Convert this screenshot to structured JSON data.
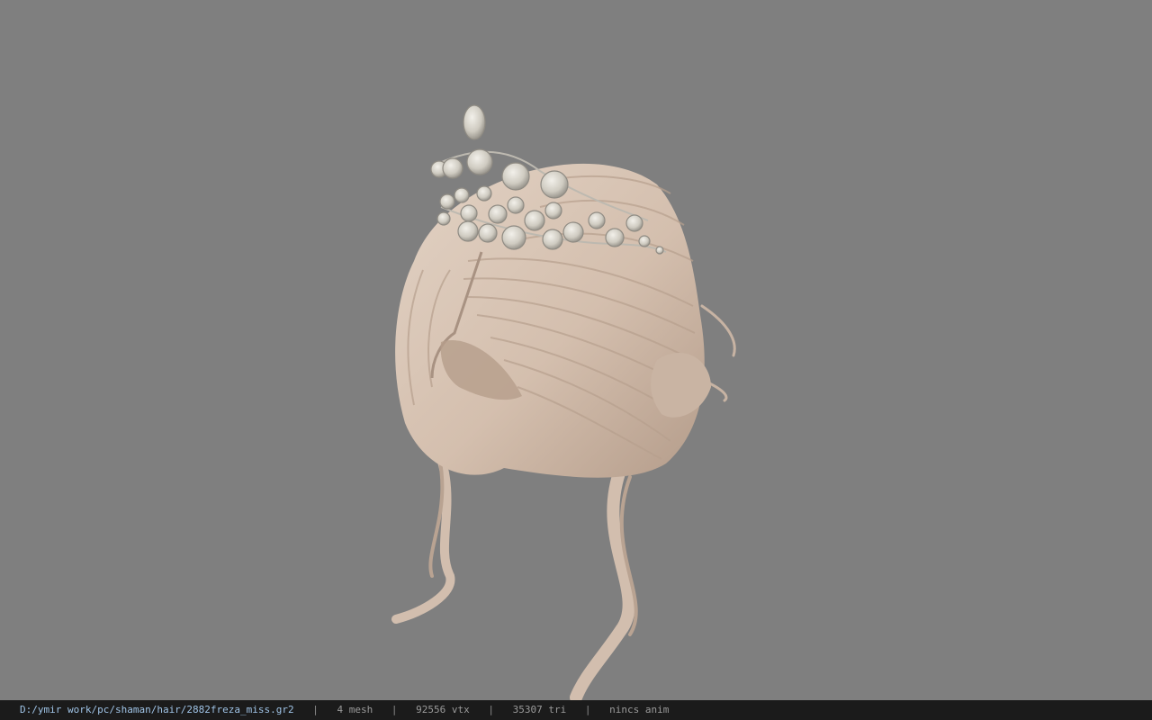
{
  "status_bar": {
    "file_path": "D:/ymir work/pc/shaman/hair/2882freza_miss.gr2",
    "separator": "|",
    "mesh_count": "4 mesh",
    "vertex_count": "92556 vtx",
    "triangle_count": "35307 tri",
    "anim_status": "nincs anim"
  },
  "colors": {
    "background": "#7f7f7f",
    "status_bar_bg": "#1b1b1b",
    "path_text": "#9fc3e6",
    "status_text": "#9a9a9a",
    "hair_base": "#d8c6b6",
    "hair_shadow": "#a89282",
    "tiara": "#cfccc4"
  },
  "viewport": {
    "model": "hair-with-tiara-model",
    "icon": "3d-model-icon"
  }
}
